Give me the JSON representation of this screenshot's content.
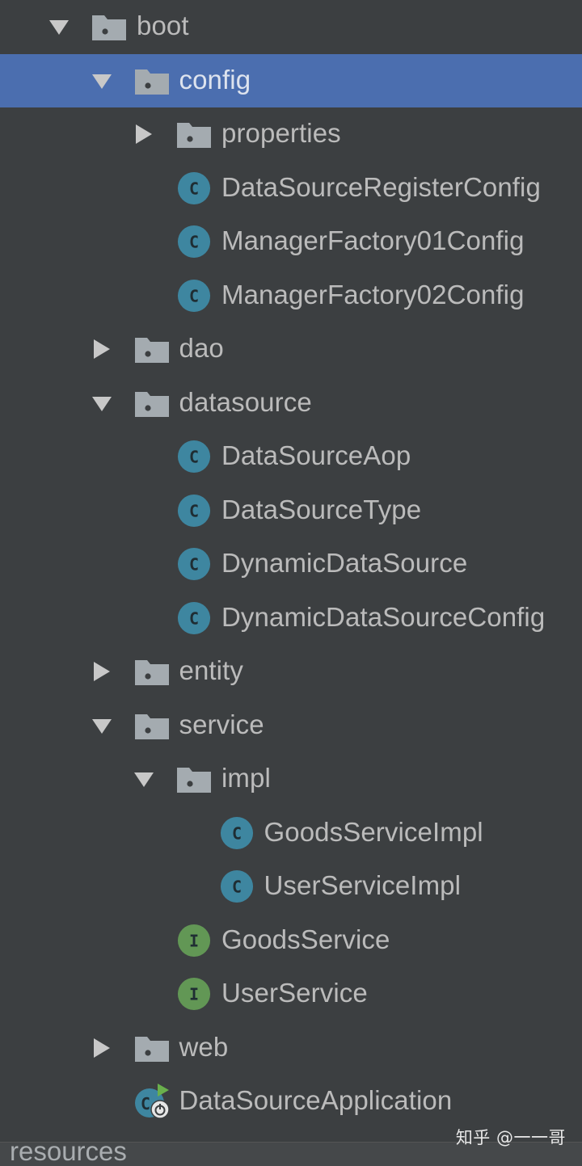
{
  "colors": {
    "background": "#3c3f41",
    "selection": "#4b6eaf",
    "text": "#bbbbbb",
    "folder": "#a4abb0",
    "class_icon": "#3e86a0",
    "interface_icon": "#629755",
    "spring_green": "#6ab04c"
  },
  "tree": [
    {
      "label": "boot",
      "type": "package",
      "arrow": "down",
      "depth": 0,
      "selected": false
    },
    {
      "label": "config",
      "type": "package",
      "arrow": "down",
      "depth": 1,
      "selected": true
    },
    {
      "label": "properties",
      "type": "package",
      "arrow": "right",
      "depth": 2,
      "selected": false
    },
    {
      "label": "DataSourceRegisterConfig",
      "type": "class",
      "icon_letter": "C",
      "depth": 2,
      "selected": false
    },
    {
      "label": "ManagerFactory01Config",
      "type": "class",
      "icon_letter": "C",
      "depth": 2,
      "selected": false
    },
    {
      "label": "ManagerFactory02Config",
      "type": "class",
      "icon_letter": "C",
      "depth": 2,
      "selected": false
    },
    {
      "label": "dao",
      "type": "package",
      "arrow": "right",
      "depth": 1,
      "selected": false
    },
    {
      "label": "datasource",
      "type": "package",
      "arrow": "down",
      "depth": 1,
      "selected": false
    },
    {
      "label": "DataSourceAop",
      "type": "class",
      "icon_letter": "C",
      "depth": 2,
      "selected": false
    },
    {
      "label": "DataSourceType",
      "type": "class",
      "icon_letter": "C",
      "depth": 2,
      "selected": false
    },
    {
      "label": "DynamicDataSource",
      "type": "class",
      "icon_letter": "C",
      "depth": 2,
      "selected": false
    },
    {
      "label": "DynamicDataSourceConfig",
      "type": "class",
      "icon_letter": "C",
      "depth": 2,
      "selected": false
    },
    {
      "label": "entity",
      "type": "package",
      "arrow": "right",
      "depth": 1,
      "selected": false
    },
    {
      "label": "service",
      "type": "package",
      "arrow": "down",
      "depth": 1,
      "selected": false
    },
    {
      "label": "impl",
      "type": "package",
      "arrow": "down",
      "depth": 2,
      "selected": false
    },
    {
      "label": "GoodsServiceImpl",
      "type": "class",
      "icon_letter": "C",
      "depth": 3,
      "selected": false
    },
    {
      "label": "UserServiceImpl",
      "type": "class",
      "icon_letter": "C",
      "depth": 3,
      "selected": false
    },
    {
      "label": "GoodsService",
      "type": "interface",
      "icon_letter": "I",
      "depth": 2,
      "selected": false
    },
    {
      "label": "UserService",
      "type": "interface",
      "icon_letter": "I",
      "depth": 2,
      "selected": false
    },
    {
      "label": "web",
      "type": "package",
      "arrow": "right",
      "depth": 1,
      "selected": false
    },
    {
      "label": "DataSourceApplication",
      "type": "spring-app",
      "depth": 1,
      "selected": false
    }
  ],
  "bottom": {
    "label": "resources"
  },
  "watermark": "知乎 @一一哥"
}
